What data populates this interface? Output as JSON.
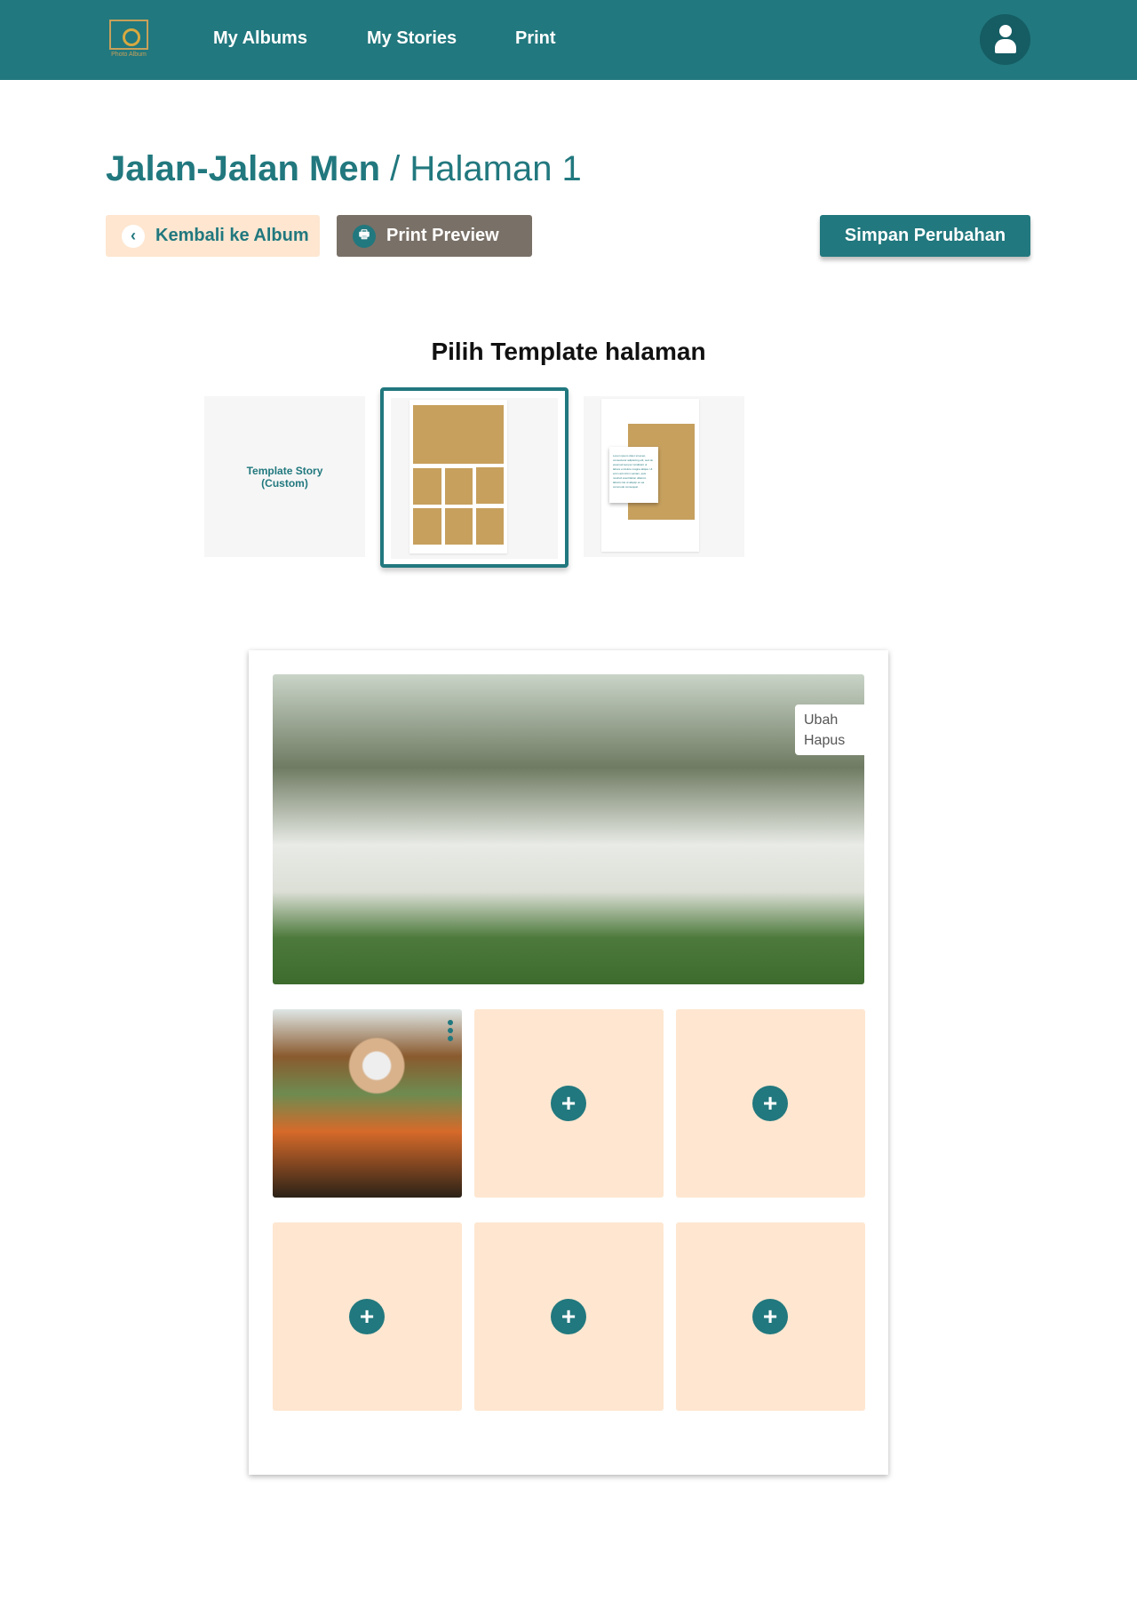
{
  "header": {
    "logo_text": "Photo Album",
    "nav": [
      {
        "label": "My Albums"
      },
      {
        "label": "My Stories"
      },
      {
        "label": "Print"
      }
    ],
    "avatar_icon": "user-icon"
  },
  "title": {
    "album": "Jalan-Jalan Men",
    "separator": " / ",
    "page": "Halaman 1"
  },
  "actions": {
    "back": "Kembali ke Album",
    "print_preview": "Print Preview",
    "save": "Simpan Perubahan"
  },
  "templates": {
    "heading": "Pilih Template halaman",
    "items": [
      {
        "label_line1": "Template Story",
        "label_line2": "(Custom)"
      },
      {
        "name": "grid-1-plus-6",
        "selected": true
      },
      {
        "name": "photo-with-text",
        "sample_text": "Lorem ipsum dolor sit amet, consectetur adipiscing elit, sed do eiusmod tempor incididunt ut labore et dolore magna aliqua. Ut enim ad minim veniam, quis nostrud exercitation ullamco laboris nisi ut aliquip ex ea commodo consequat."
      }
    ]
  },
  "page": {
    "photo_menu": {
      "edit": "Ubah",
      "delete": "Hapus"
    },
    "empty_slot_icon": "plus-icon"
  },
  "colors": {
    "primary": "#21787e",
    "accent_light": "#fee6d0",
    "gold": "#c7a05e",
    "print_btn": "#797067"
  }
}
